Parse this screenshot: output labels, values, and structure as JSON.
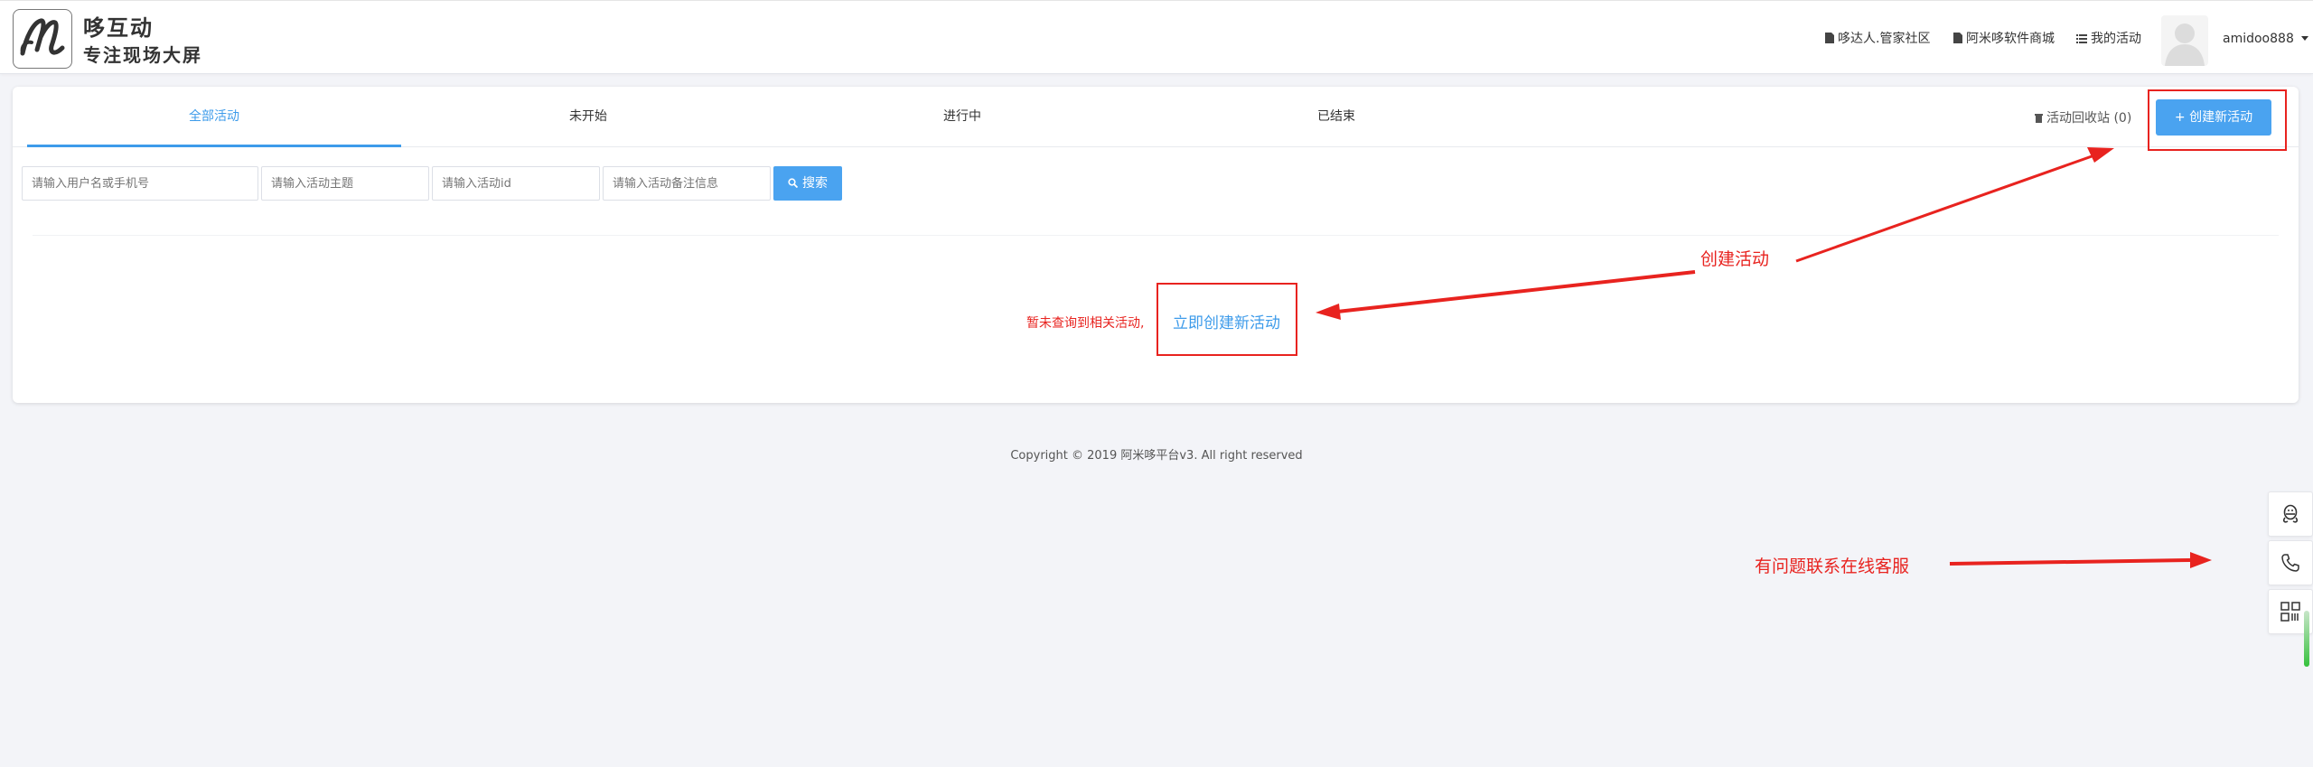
{
  "header": {
    "brand_line1": "哆互动",
    "brand_line2": "专注现场大屏",
    "links": [
      {
        "label": "哆达人.管家社区",
        "icon": "document-icon"
      },
      {
        "label": "阿米哆软件商城",
        "icon": "document-icon"
      },
      {
        "label": "我的活动",
        "icon": "list-icon"
      }
    ],
    "username": "amidoo888"
  },
  "tabs": [
    {
      "label": "全部活动",
      "active": true
    },
    {
      "label": "未开始",
      "active": false
    },
    {
      "label": "进行中",
      "active": false
    },
    {
      "label": "已结束",
      "active": false
    }
  ],
  "recycle_label": "活动回收站 (0)",
  "create_button": "+ 创建新活动",
  "filters": {
    "user_placeholder": "请输入用户名或手机号",
    "topic_placeholder": "请输入活动主题",
    "id_placeholder": "请输入活动id",
    "note_placeholder": "请输入活动备注信息",
    "search_label": "搜索"
  },
  "empty_state": {
    "message": "暂未查询到相关活动,",
    "link": "立即创建新活动"
  },
  "copyright": "Copyright © 2019 阿米哆平台v3. All right reserved",
  "annotations": {
    "create": "创建活动",
    "service": "有问题联系在线客服"
  },
  "side_tools": [
    "qq-icon",
    "phone-icon",
    "qrcode-icon"
  ],
  "colors": {
    "primary": "#4aa3f0",
    "annotation": "#e8231f"
  }
}
